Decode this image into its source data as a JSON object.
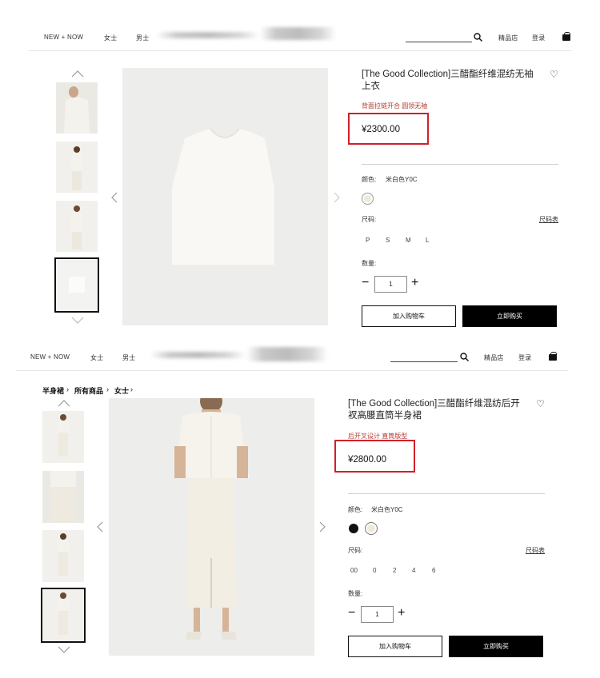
{
  "top": {
    "header": {
      "nav_new": "NEW + NOW",
      "nav_women": "女士",
      "nav_men": "男士",
      "nav_boutique": "精品店",
      "nav_login": "登录"
    },
    "product": {
      "title": "[The Good Collection]三醋酯纤维混纺无袖上衣",
      "tags": "背面拉链开合 圆领无袖",
      "price": "¥2300.00",
      "color_label": "颜色:",
      "color_value": "米白色Y0C",
      "size_label": "尺码:",
      "size_guide": "尺码表",
      "sizes": [
        "P",
        "S",
        "M",
        "L"
      ],
      "qty_label": "数量:",
      "qty_value": "1",
      "add_to_cart": "加入购物车",
      "buy_now": "立即购买"
    }
  },
  "bottom": {
    "header": {
      "nav_new": "NEW + NOW",
      "nav_women": "女士",
      "nav_men": "男士",
      "nav_boutique": "精品店",
      "nav_login": "登录"
    },
    "breadcrumb": [
      "半身裙",
      "所有商品",
      "女士"
    ],
    "product": {
      "title_line1": "[The Good Collection]三醋酯纤维混纺后开",
      "title_line2": "衩高腰直筒半身裙",
      "tags": "后开叉设计 直筒版型",
      "price": "¥2800.00",
      "color_label": "颜色:",
      "color_value": "米白色Y0C",
      "size_label": "尺码:",
      "size_guide": "尺码表",
      "sizes": [
        "00",
        "0",
        "2",
        "4",
        "6"
      ],
      "qty_label": "数量:",
      "qty_value": "1",
      "add_to_cart": "加入购物车",
      "buy_now": "立即购买"
    }
  },
  "colors": {
    "price_highlight": "#d0202a",
    "tag_text": "#b03a2e",
    "button_dark": "#000000",
    "swatch_offwhite": "#efe9dc",
    "swatch_black": "#111111"
  },
  "icons": [
    "search-icon",
    "bag-icon",
    "heart-icon",
    "chevron-up-icon",
    "chevron-down-icon",
    "chevron-left-icon",
    "chevron-right-icon",
    "minus-icon",
    "plus-icon"
  ]
}
